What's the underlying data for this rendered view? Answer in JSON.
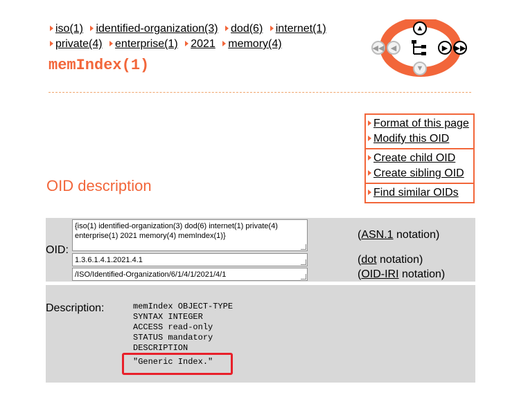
{
  "breadcrumb": [
    {
      "label": "iso(1)"
    },
    {
      "label": "identified-organization(3)"
    },
    {
      "label": "dod(6)"
    },
    {
      "label": "internet(1)"
    },
    {
      "label": "private(4)"
    },
    {
      "label": "enterprise(1)"
    },
    {
      "label": "2021"
    },
    {
      "label": "memory(4)"
    }
  ],
  "page_title": "memIndex(1)",
  "actions": {
    "format": "Format of this page",
    "modify": "Modify this OID",
    "create_child": "Create child OID",
    "create_sibling": "Create sibling OID",
    "find_similar": "Find similar OIDs"
  },
  "section_heading": "OID description",
  "oid": {
    "label": "OID:",
    "asn1_value": "{iso(1) identified-organization(3) dod(6) internet(1) private(4) enterprise(1) 2021 memory(4) memIndex(1)}",
    "dot_value": "1.3.6.1.4.1.2021.4.1",
    "iri_value": "/ISO/Identified-Organization/6/1/4/1/2021/4/1",
    "asn1_link": "ASN.1",
    "asn1_suffix": " notation)",
    "dot_link": "dot",
    "dot_suffix": " notation)",
    "iri_link": "OID-IRI",
    "iri_suffix": " notation)",
    "open_paren": "("
  },
  "description": {
    "label": "Description:",
    "text": "memIndex OBJECT-TYPE\nSYNTAX INTEGER\nACCESS read-only\nSTATUS mandatory\nDESCRIPTION",
    "quote": "\"Generic Index.\""
  },
  "nav_widget": {
    "icons": [
      "first-icon",
      "previous-icon",
      "parent-icon",
      "tree-icon",
      "child-icon",
      "next-icon",
      "last-icon"
    ],
    "accent_color": "#f2663a"
  }
}
